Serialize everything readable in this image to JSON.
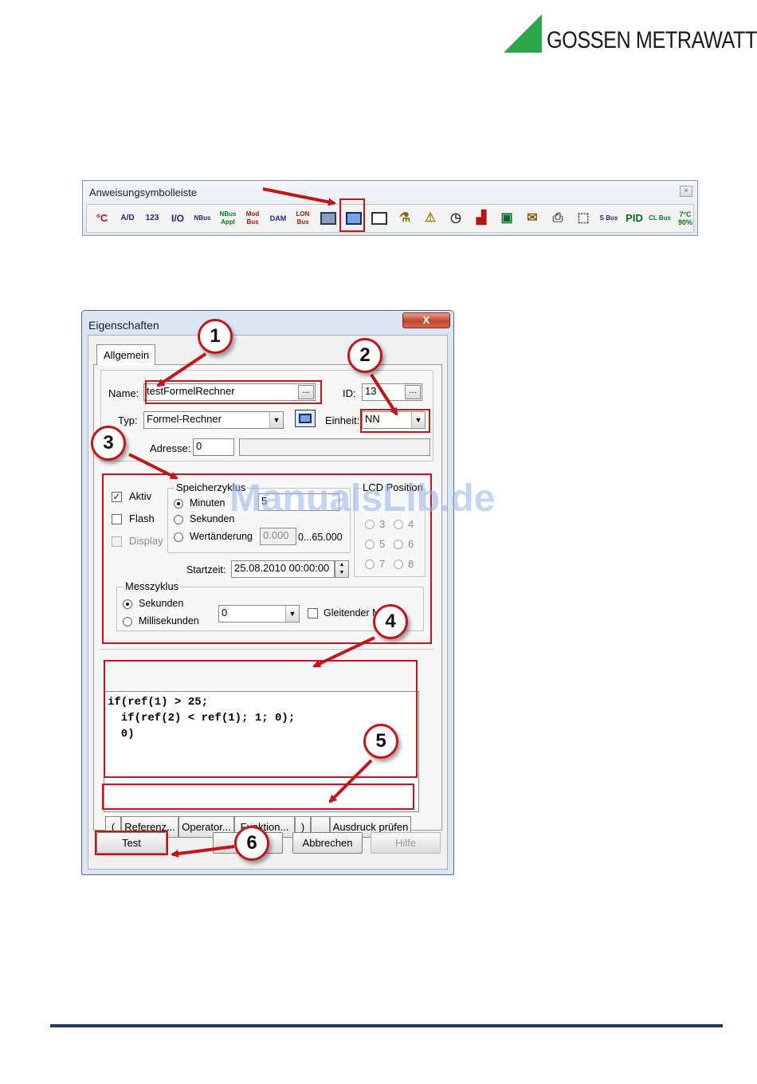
{
  "brand": {
    "name": "GOSSEN METRAWATT",
    "color": "#2aa84a"
  },
  "toolbar": {
    "title": "Anweisungsymbolleiste",
    "close_label": "×",
    "icons": [
      {
        "label": "°C",
        "name": "temperature-icon"
      },
      {
        "label": "A/D",
        "name": "analog-digital-icon"
      },
      {
        "label": "123",
        "name": "counter-icon"
      },
      {
        "label": "I/O",
        "name": "io-icon"
      },
      {
        "label": "NBus",
        "name": "nbus-icon"
      },
      {
        "label": "NBus Appl",
        "name": "nbus-appl-icon"
      },
      {
        "label": "Mod Bus",
        "name": "modbus-icon"
      },
      {
        "label": "DAM",
        "name": "dam-icon"
      },
      {
        "label": "LON Bus",
        "name": "lon-bus-icon"
      },
      {
        "label": "",
        "name": "device-icon"
      },
      {
        "label": "",
        "name": "formula-calculator-icon"
      },
      {
        "label": "",
        "name": "window-icon"
      },
      {
        "label": "",
        "name": "flask-icon"
      },
      {
        "label": "",
        "name": "alarm-icon"
      },
      {
        "label": "",
        "name": "clock-icon"
      },
      {
        "label": "",
        "name": "chart-icon"
      },
      {
        "label": "",
        "name": "timer-icon"
      },
      {
        "label": "",
        "name": "mail-icon"
      },
      {
        "label": "",
        "name": "printer-icon"
      },
      {
        "label": "",
        "name": "trend-icon"
      },
      {
        "label": "S Bus",
        "name": "sbus-icon"
      },
      {
        "label": "PID",
        "name": "pid-icon"
      },
      {
        "label": "CL Bus",
        "name": "cl-bus-icon"
      },
      {
        "label": "7°C 90%",
        "name": "climate-icon"
      }
    ]
  },
  "dialog": {
    "title": "Eigenschaften",
    "close_label": "X",
    "tab": "Allgemein",
    "name_label": "Name:",
    "name_value": "testFormelRechner",
    "dots": "...",
    "id_label": "ID:",
    "id_value": "13",
    "typ_label": "Typ:",
    "typ_value": "Formel-Rechner",
    "einheit_label": "Einheit:",
    "einheit_value": "NN",
    "adresse_label": "Adresse:",
    "adresse_value": "0",
    "aktiv_label": "Aktiv",
    "flash_label": "Flash",
    "display_label": "Display",
    "speicher_title": "Speicherzyklus",
    "minuten_label": "Minuten",
    "minuten_value": "5",
    "sekunden_label": "Sekunden",
    "wertaenderung_label": "Wertänderung",
    "wertaenderung_value": "0.000",
    "range_label": "0...65.000",
    "lcd_title": "LCD Position",
    "lcd_positions": [
      "3",
      "4",
      "5",
      "6",
      "7",
      "8"
    ],
    "startzeit_label": "Startzeit:",
    "startzeit_value": "25.08.2010 00:00:00",
    "messzyklus_title": "Messzyklus",
    "mess_sekunden_label": "Sekunden",
    "mess_millisekunden_label": "Millisekunden",
    "mess_value": "0",
    "gleitender_label": "Gleitender M",
    "code": "if(ref(1) > 25;\n  if(ref(2) < ref(1); 1; 0);\n  0)",
    "expr_buttons": [
      "(",
      "Referenz...",
      "Operator...",
      "Funktion...",
      ")",
      "",
      "Ausdruck prüfen"
    ],
    "test_label": "Test",
    "ok_label": "",
    "abbrechen_label": "Abbrechen",
    "hilfe_label": "Hilfe"
  },
  "callouts": [
    "1",
    "2",
    "3",
    "4",
    "5",
    "6"
  ],
  "watermark": "ManualsLib.de",
  "accent_color": "#c0151a"
}
